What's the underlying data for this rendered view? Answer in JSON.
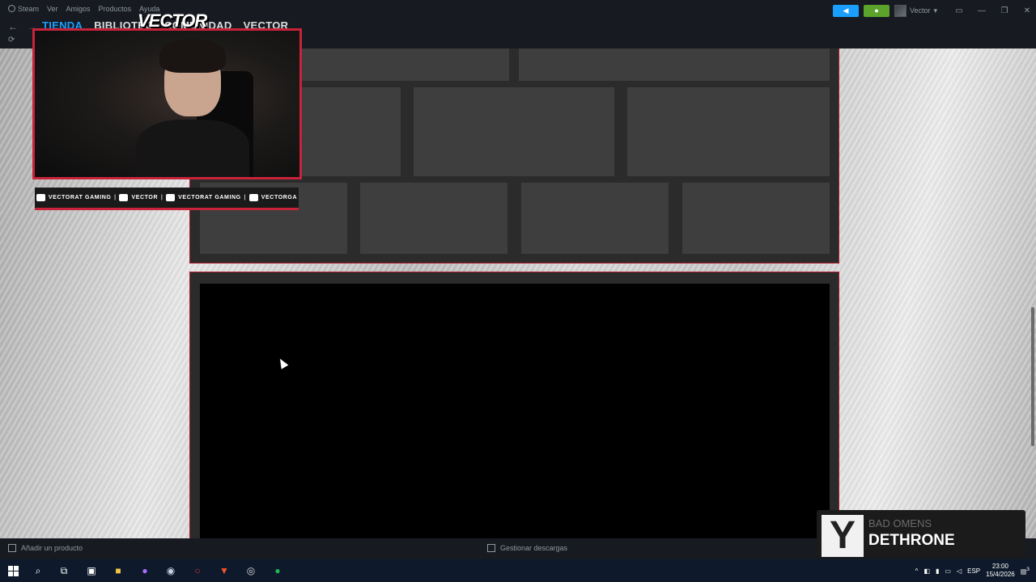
{
  "menu": {
    "app": "Steam",
    "items": [
      "Ver",
      "Amigos",
      "Productos",
      "Ayuda"
    ]
  },
  "user": {
    "name": "Vector"
  },
  "tabs": [
    "TIENDA",
    "BIBLIOTEC",
    "COMUNIDAD",
    "VECTOR"
  ],
  "overlay": {
    "logo_text": "VECTOR",
    "socials": [
      {
        "icon": "youtube-icon",
        "label": "VECTORAT GAMING"
      },
      {
        "icon": "twitch-icon",
        "label": "VECTOR"
      },
      {
        "icon": "twitter-icon",
        "label": "VECTORAT GAMING"
      },
      {
        "icon": "instagram-icon",
        "label": "VECTORGA"
      }
    ]
  },
  "bottombar": {
    "add_product": "Añadir un producto",
    "manage_downloads": "Gestionar descargas"
  },
  "now_playing": {
    "artist": "BAD OMENS",
    "track": "DETHRONE"
  },
  "taskbar": {
    "lang": "ESP",
    "time": "23:00",
    "date": "15/4/2026",
    "notifications": "3"
  },
  "colors": {
    "accent": "#1a9fff",
    "overlay_red": "#c8233a",
    "green": "#5ba32b"
  }
}
